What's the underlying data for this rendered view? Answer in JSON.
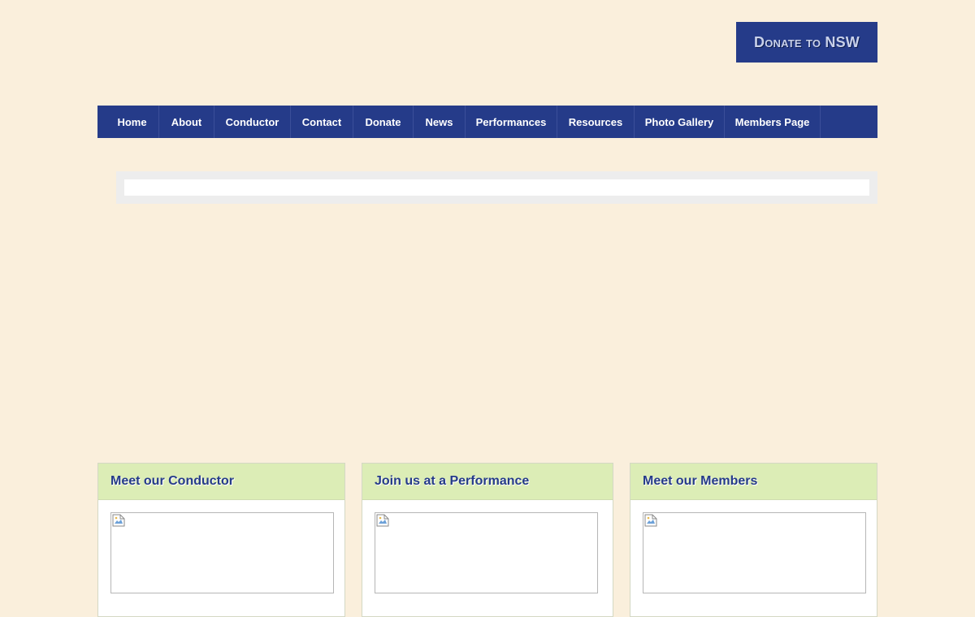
{
  "header": {
    "donate_label": "Donate to NSW"
  },
  "nav": {
    "items": [
      {
        "label": "Home"
      },
      {
        "label": "About"
      },
      {
        "label": "Conductor"
      },
      {
        "label": "Contact"
      },
      {
        "label": "Donate"
      },
      {
        "label": "News"
      },
      {
        "label": "Performances"
      },
      {
        "label": "Resources"
      },
      {
        "label": "Photo Gallery"
      },
      {
        "label": "Members Page"
      }
    ]
  },
  "cards": [
    {
      "title": "Meet our Conductor",
      "image_icon": "broken-image-icon"
    },
    {
      "title": "Join us at a Performance",
      "image_icon": "broken-image-icon"
    },
    {
      "title": "Meet our Members",
      "image_icon": "broken-image-icon"
    }
  ],
  "colors": {
    "background": "#faefdc",
    "nav_blue": "#253b89",
    "card_header": "#dcedb6"
  }
}
